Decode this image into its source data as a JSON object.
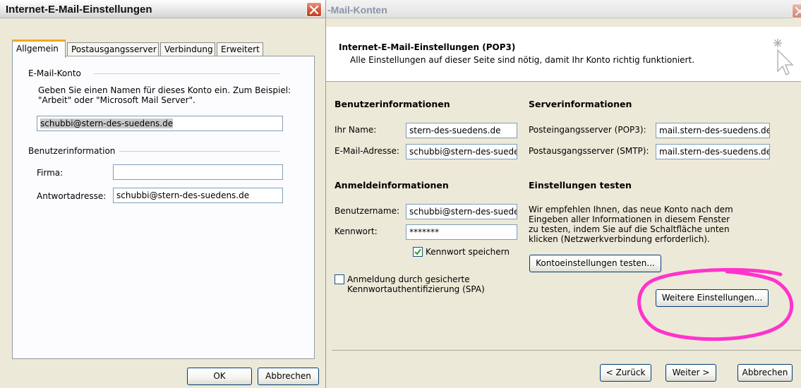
{
  "left_dialog": {
    "title": "Internet-E-Mail-Einstellungen",
    "tabs": [
      "Allgemein",
      "Postausgangsserver",
      "Verbindung",
      "Erweitert"
    ],
    "email_account": {
      "group_label": "E-Mail-Konto",
      "description": "Geben Sie einen Namen für dieses Konto ein. Zum Beispiel: \"Arbeit\" oder \"Microsoft Mail Server\".",
      "value": "schubbi@stern-des-suedens.de"
    },
    "user_info": {
      "group_label": "Benutzerinformation",
      "company_label": "Firma:",
      "company_value": "",
      "reply_label": "Antwortadresse:",
      "reply_value": "schubbi@stern-des-suedens.de"
    },
    "buttons": {
      "ok": "OK",
      "cancel": "Abbrechen"
    }
  },
  "right_dialog": {
    "title": "-Mail-Konten",
    "header": {
      "title": "Internet-E-Mail-Einstellungen (POP3)",
      "subtitle": "Alle Einstellungen auf dieser Seite sind nötig, damit Ihr Konto richtig funktioniert."
    },
    "user_info": {
      "heading": "Benutzerinformationen",
      "name_label": "Ihr Name:",
      "name_value": "stern-des-suedens.de",
      "email_label": "E-Mail-Adresse:",
      "email_value": "schubbi@stern-des-sueden"
    },
    "server_info": {
      "heading": "Serverinformationen",
      "incoming_label": "Posteingangsserver (POP3):",
      "incoming_value": "mail.stern-des-suedens.de",
      "outgoing_label": "Postausgangsserver (SMTP):",
      "outgoing_value": "mail.stern-des-suedens.de"
    },
    "login_info": {
      "heading": "Anmeldeinformationen",
      "username_label": "Benutzername:",
      "username_value": "schubbi@stern-des-sueden",
      "password_label": "Kennwort:",
      "password_value": "*******",
      "remember_label": "Kennwort speichern",
      "remember_checked": true,
      "spa_label": "Anmeldung durch gesicherte Kennwortauthentifizierung (SPA)",
      "spa_checked": false
    },
    "test_settings": {
      "heading": "Einstellungen testen",
      "description": "Wir empfehlen Ihnen, das neue Konto nach dem Eingeben aller Informationen in diesem Fenster zu testen, indem Sie auf die Schaltfläche unten klicken (Netzwerkverbindung erforderlich).",
      "test_button": "Kontoeinstellungen testen...",
      "more_button": "Weitere Einstellungen..."
    },
    "nav": {
      "back": "< Zurück",
      "next": "Weiter >",
      "cancel": "Abbrechen"
    },
    "highlight_color": "#ff33cc"
  }
}
